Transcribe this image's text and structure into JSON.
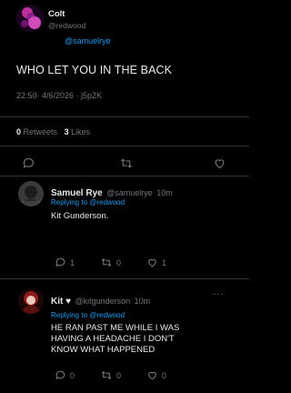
{
  "main_tweet": {
    "author_name": "Colt",
    "author_handle": "@redwood",
    "reply_to": "@samuelrye",
    "text": "WHO LET YOU IN THE BACK",
    "meta": "22:50· 4/6/2026 · j5p2K",
    "retweets_count": "0",
    "retweets_label": "Retweets",
    "likes_count": "3",
    "likes_label": "Likes"
  },
  "replies": [
    {
      "author_name": "Samuel Rye",
      "author_handle": "@samuelrye",
      "time": "10m",
      "replying_to": "Replying to @redwood",
      "text": "Kit Gunderson.",
      "reply_count": "1",
      "retweet_count": "0",
      "like_count": "1"
    },
    {
      "author_name": "Kit ♥",
      "author_handle": "@kitgunderson",
      "time": "10m",
      "replying_to": "Replying to @redwood",
      "text_line1": "HE RAN PAST ME WHILE I WAS",
      "text_line2": "HAVING A HEADACHE I DON'T",
      "text_line3": "KNOW WHAT HAPPENED",
      "reply_count": "0",
      "retweet_count": "0",
      "like_count": "0",
      "more_glyph": "···"
    }
  ],
  "colors": {
    "background": "#000000",
    "text": "#e7e9ea",
    "secondary": "#71767b",
    "accent": "#1d9bf0",
    "divider": "#2f3336"
  },
  "icons": [
    "avatar-colt",
    "avatar-samuel",
    "avatar-kit",
    "reply-icon",
    "retweet-icon",
    "like-icon",
    "more-icon"
  ]
}
